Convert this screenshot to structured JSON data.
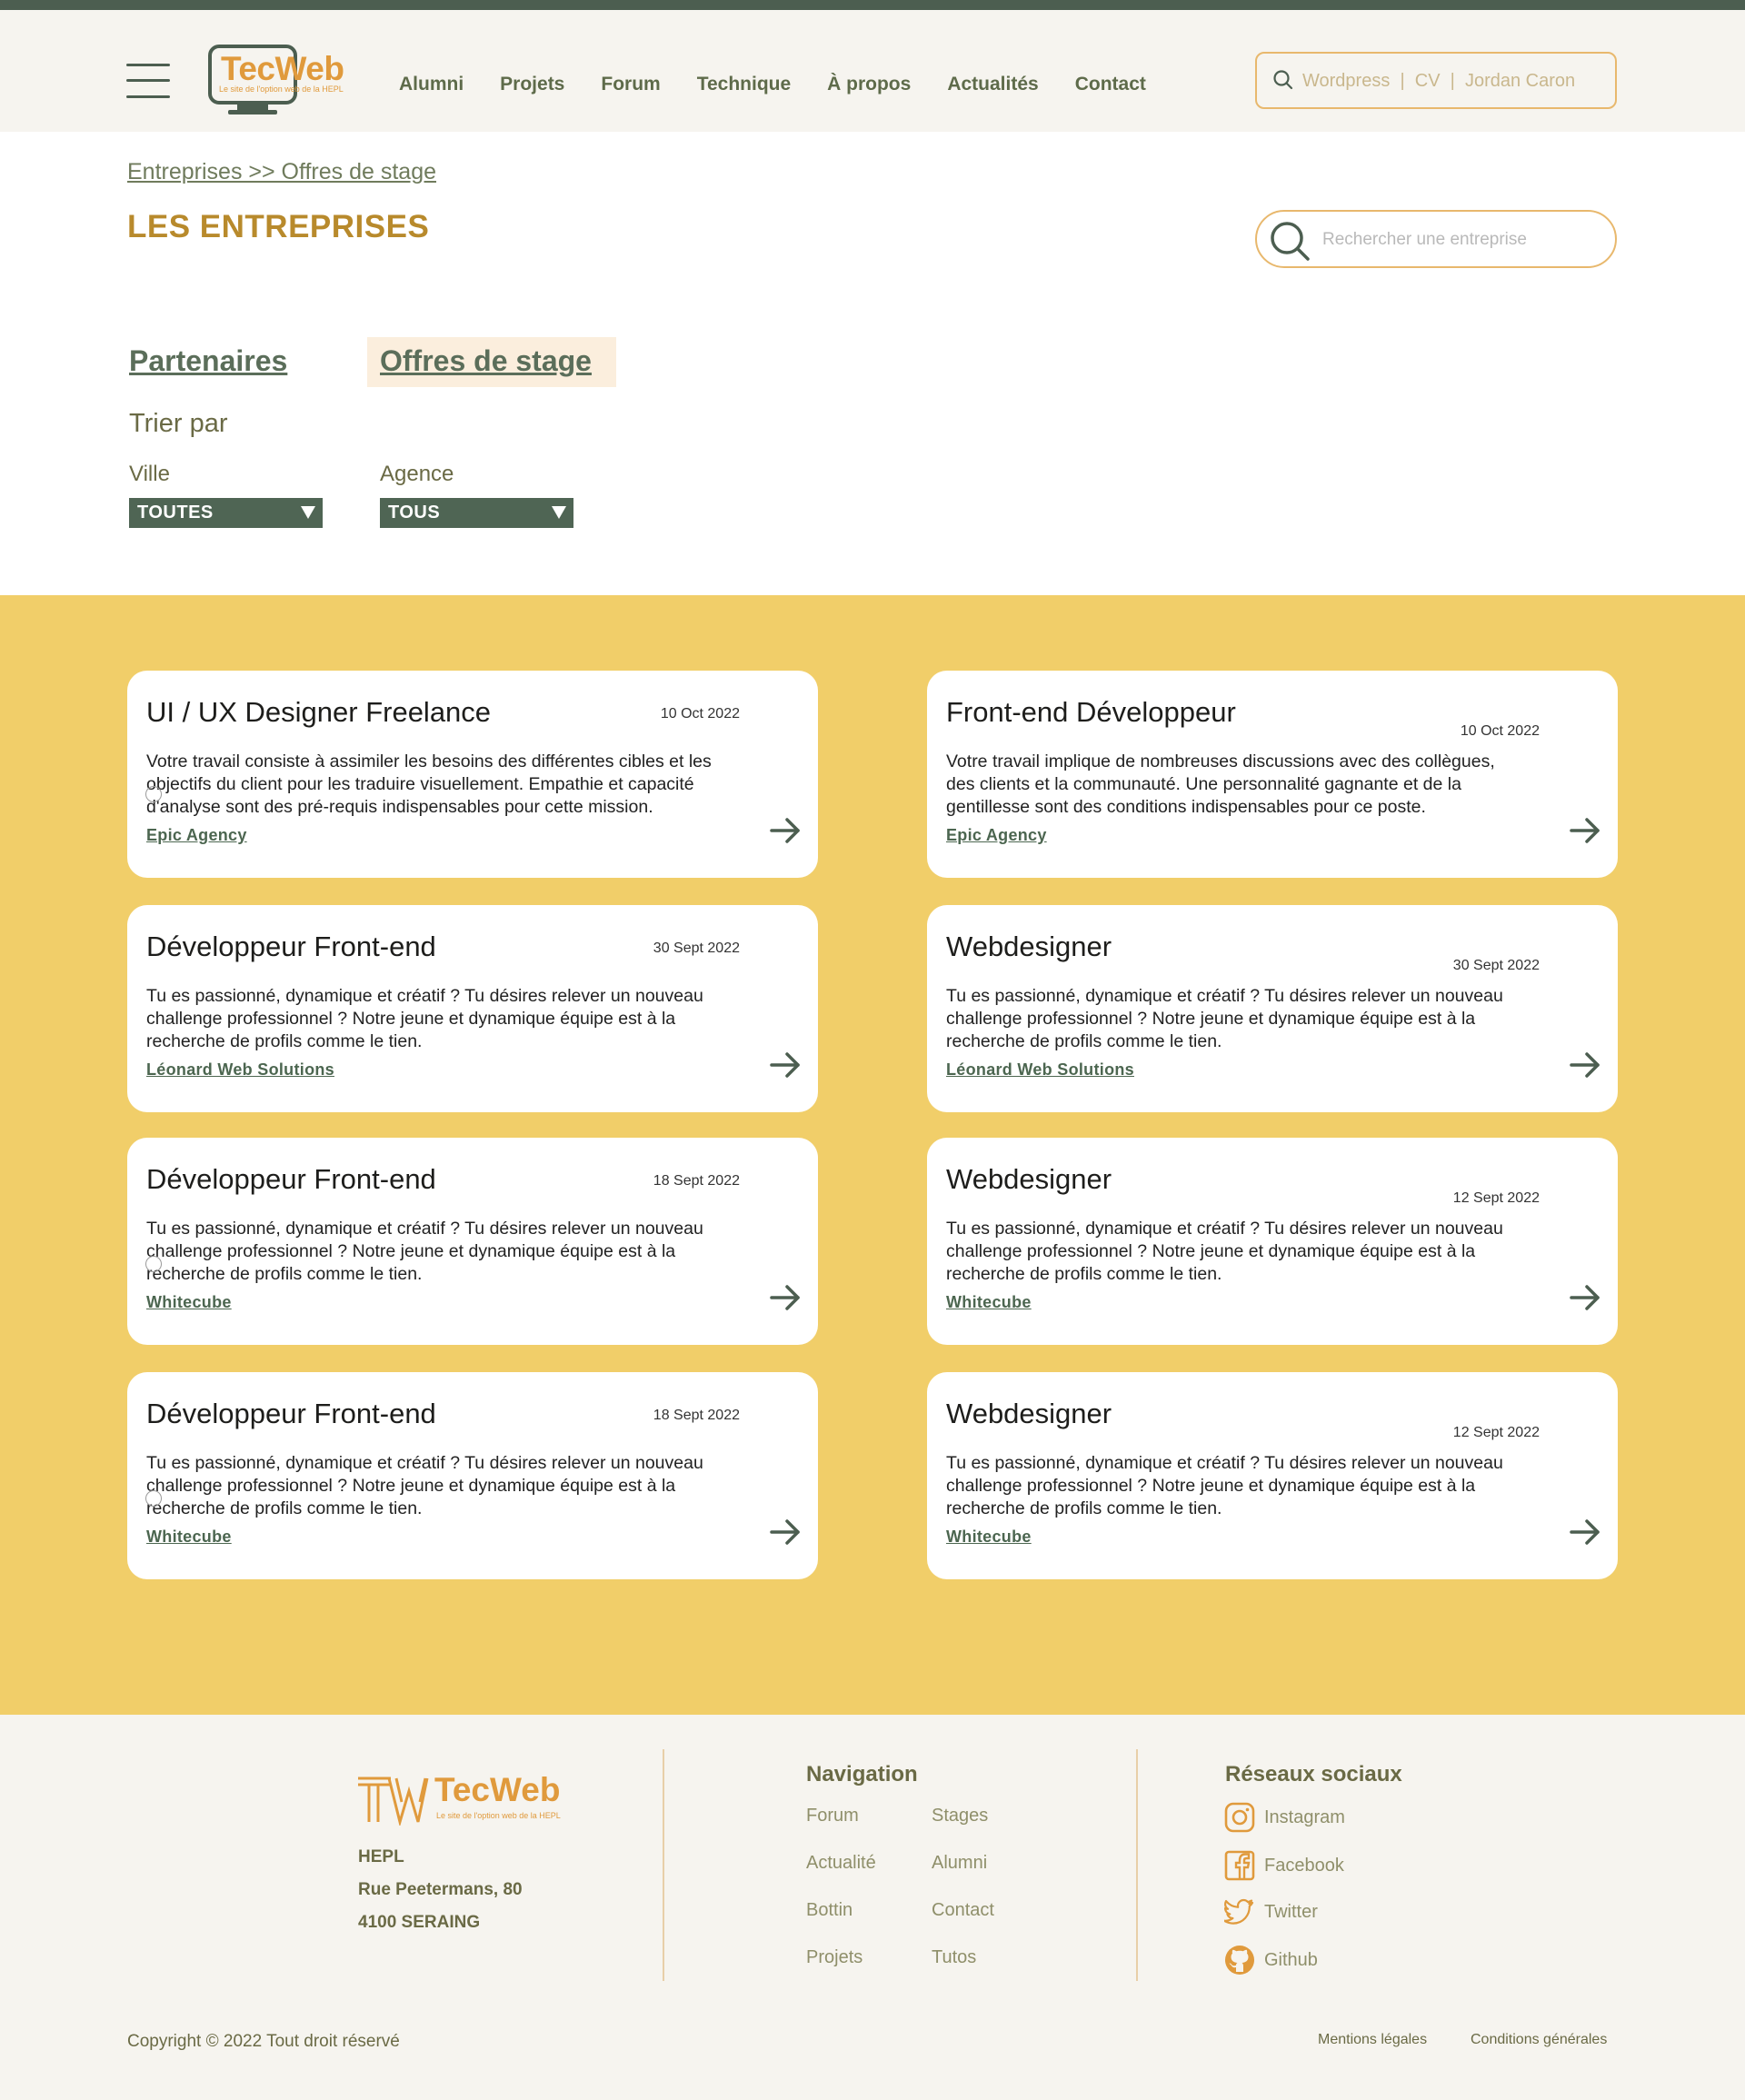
{
  "header": {
    "logo_text": "TecWeb",
    "logo_subtitle": "Le site de l'option web de la HEPL",
    "nav": [
      "Alumni",
      "Projets",
      "Forum",
      "Technique",
      "À propos",
      "Actualités",
      "Contact"
    ],
    "search_placeholder": "Wordpress  |  CV  |  Jordan Caron"
  },
  "breadcrumb": "Entreprises >> Offres de stage",
  "page_title": "LES ENTREPRISES",
  "company_search_placeholder": "Rechercher une entreprise",
  "tabs": {
    "partners": "Partenaires",
    "offers": "Offres de stage"
  },
  "sort": {
    "title": "Trier par",
    "city_label": "Ville",
    "city_value": "TOUTES",
    "agency_label": "Agence",
    "agency_value": "TOUS"
  },
  "offers": [
    {
      "title": "UI / UX Designer Freelance",
      "date": "10 Oct 2022",
      "description": "Votre travail consiste à assimiler les besoins des différentes cibles et les objectifs du client pour les traduire visuellement. Empathie et capacité d'analyse sont des pré-requis indispensables pour cette mission.",
      "company": "Epic Agency"
    },
    {
      "title": "Front-end Développeur",
      "date": "10 Oct 2022",
      "description": "Votre travail implique de nombreuses discussions avec des collègues, des clients et la communauté. Une personnalité gagnante et de la gentillesse sont des conditions indispensables pour ce poste.",
      "company": "Epic Agency"
    },
    {
      "title": "Développeur Front-end",
      "date": "30 Sept 2022",
      "description": "Tu es passionné, dynamique et créatif ? Tu désires relever un nouveau challenge professionnel ? Notre jeune et dynamique équipe est à la recherche de profils comme le tien.",
      "company": "Léonard Web Solutions"
    },
    {
      "title": "Webdesigner",
      "date": "30 Sept 2022",
      "description": "Tu es passionné, dynamique et créatif ? Tu désires relever un nouveau challenge professionnel ? Notre jeune et dynamique équipe est à la recherche de profils comme le tien.",
      "company": "Léonard Web Solutions"
    },
    {
      "title": "Développeur Front-end",
      "date": "18 Sept 2022",
      "description": "Tu es passionné, dynamique et créatif ? Tu désires relever un nouveau challenge professionnel ? Notre jeune et dynamique équipe est à la recherche de profils comme le tien.",
      "company": "Whitecube"
    },
    {
      "title": "Webdesigner",
      "date": "12 Sept 2022",
      "description": "Tu es passionné, dynamique et créatif ? Tu désires relever un nouveau challenge professionnel ? Notre jeune et dynamique équipe est à la recherche de profils comme le tien.",
      "company": "Whitecube"
    },
    {
      "title": "Développeur Front-end",
      "date": "18 Sept 2022",
      "description": "Tu es passionné, dynamique et créatif ? Tu désires relever un nouveau challenge professionnel ? Notre jeune et dynamique équipe est à la recherche de profils comme le tien.",
      "company": "Whitecube"
    },
    {
      "title": "Webdesigner",
      "date": "12 Sept 2022",
      "description": "Tu es passionné, dynamique et créatif ? Tu désires relever un nouveau challenge professionnel ? Notre jeune et dynamique équipe est à la recherche de profils comme le tien.",
      "company": "Whitecube"
    }
  ],
  "footer": {
    "logo_text": "TecWeb",
    "logo_subtitle": "Le site de l'option web de la HEPL",
    "address": [
      "HEPL",
      "Rue Peetermans, 80",
      "4100 SERAING"
    ],
    "navigation_title": "Navigation",
    "navigation_links": [
      "Forum",
      "Stages",
      "Actualité",
      "Alumni",
      "Bottin",
      "Contact",
      "Projets",
      "Tutos"
    ],
    "social_title": "Réseaux sociaux",
    "social_links": [
      {
        "label": "Instagram",
        "icon": "instagram-icon"
      },
      {
        "label": "Facebook",
        "icon": "facebook-icon"
      },
      {
        "label": "Twitter",
        "icon": "twitter-icon"
      },
      {
        "label": "Github",
        "icon": "github-icon"
      }
    ],
    "copyright": "Copyright © 2022 Tout droit réservé",
    "legal": "Mentions légales",
    "terms": "Conditions générales"
  },
  "colors": {
    "accent_green": "#4c5e50",
    "gold_title": "#b88a2c",
    "orange_logo": "#e09a3c",
    "section_yellow": "#f1ce69",
    "background_cream": "#f6f4ef"
  }
}
